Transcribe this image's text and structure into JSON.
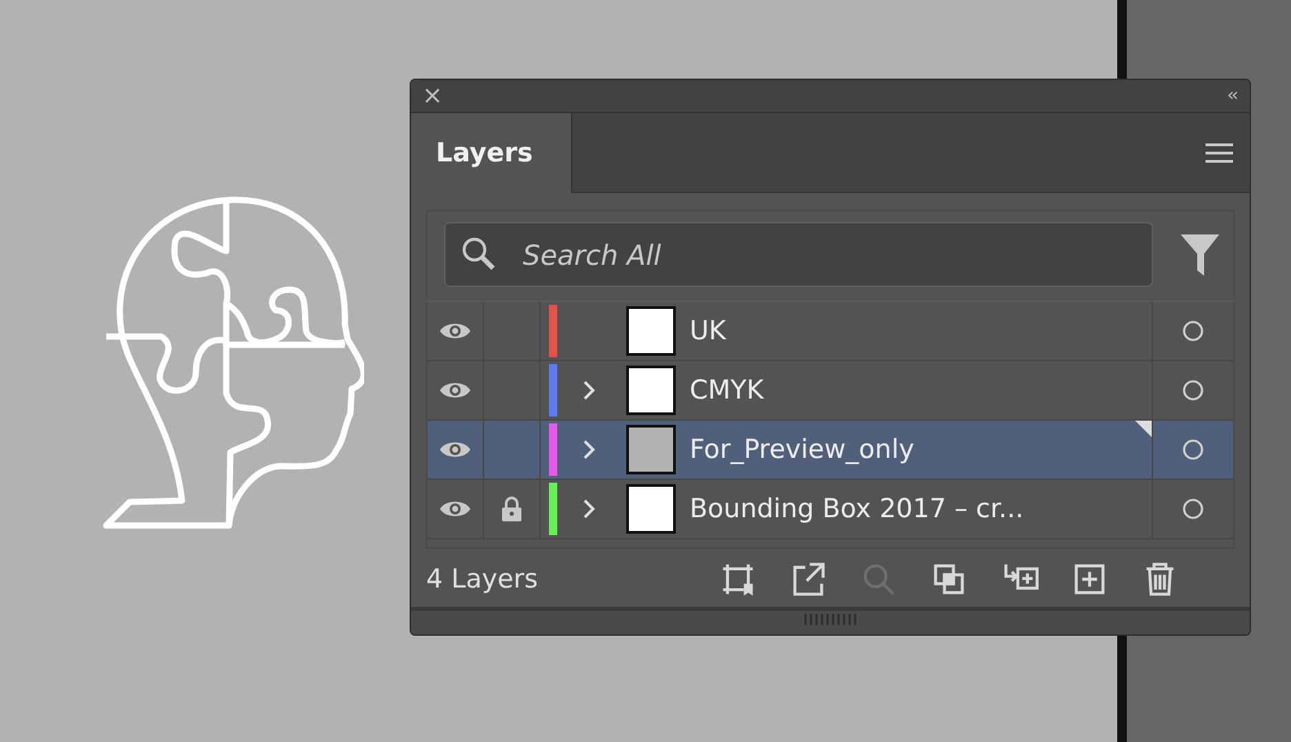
{
  "panel": {
    "close_glyph": "×",
    "collapse_glyph": "‹‹",
    "tabs": [
      {
        "label": "Layers",
        "selected": true
      }
    ],
    "search": {
      "placeholder": "Search All"
    },
    "layers": [
      {
        "name": "UK",
        "visible": true,
        "locked": false,
        "color": "#e5524a",
        "expandable": false,
        "thumbnail_shaded": false,
        "selected": false
      },
      {
        "name": "CMYK",
        "visible": true,
        "locked": false,
        "color": "#5a7cf0",
        "expandable": true,
        "thumbnail_shaded": false,
        "selected": false
      },
      {
        "name": "For_Preview_only",
        "visible": true,
        "locked": false,
        "color": "#e95ae9",
        "expandable": true,
        "thumbnail_shaded": true,
        "selected": true
      },
      {
        "name": "Bounding Box 2017 – cr...",
        "visible": true,
        "locked": true,
        "color": "#66ee55",
        "expandable": true,
        "thumbnail_shaded": false,
        "selected": false
      }
    ],
    "layer_count": "4 Layers",
    "tools": [
      {
        "kind": "artboard",
        "disabled": false
      },
      {
        "kind": "export",
        "disabled": false
      },
      {
        "kind": "locate",
        "disabled": true
      },
      {
        "kind": "clip",
        "disabled": false
      },
      {
        "kind": "move",
        "disabled": false
      },
      {
        "kind": "new",
        "disabled": false
      },
      {
        "kind": "delete",
        "disabled": false
      }
    ]
  }
}
